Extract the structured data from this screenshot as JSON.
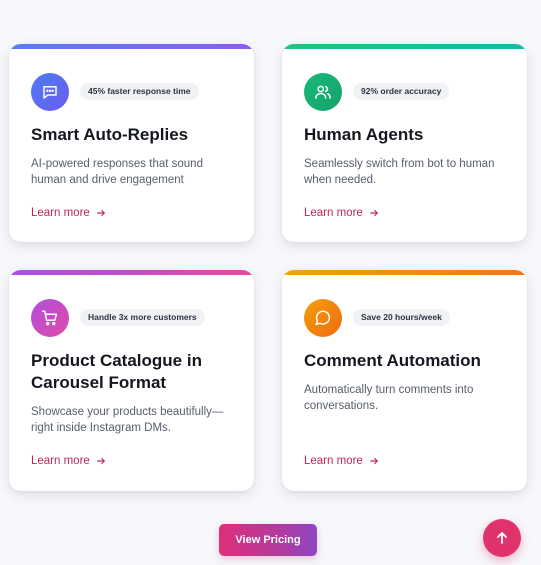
{
  "cards": [
    {
      "icon": "chat-dots-icon",
      "badge": "45% faster response time",
      "title": "Smart Auto-Replies",
      "description": "AI-powered responses that sound human and drive engagement",
      "link": "Learn more",
      "colors": {
        "bar": [
          "#5b7cf0",
          "#8a5cf0"
        ],
        "icon": [
          "#4d7bf3",
          "#6a5cf0"
        ]
      }
    },
    {
      "icon": "users-icon",
      "badge": "92% order accuracy",
      "title": "Human Agents",
      "description": "Seamlessly switch from bot to human when needed.",
      "link": "Learn more",
      "colors": {
        "bar": [
          "#22c57a",
          "#14b8a6"
        ],
        "icon": [
          "#18b87a",
          "#15a36c"
        ]
      }
    },
    {
      "icon": "cart-icon",
      "badge": "Handle 3x more customers",
      "title": "Product Catalogue in Carousel Format",
      "description": "Showcase your products beautifully—right inside Instagram DMs.",
      "link": "Learn more",
      "colors": {
        "bar": [
          "#a64ff2",
          "#ec4899"
        ],
        "icon": [
          "#b14fe0",
          "#e04aa6"
        ]
      }
    },
    {
      "icon": "comment-icon",
      "badge": "Save 20 hours/week",
      "title": "Comment Automation",
      "description": "Automatically turn comments into conversations.",
      "link": "Learn more",
      "colors": {
        "bar": [
          "#f5a30b",
          "#f97316"
        ],
        "icon": [
          "#f59e0b",
          "#ef6c12"
        ]
      }
    }
  ],
  "view_pricing_label": "View Pricing",
  "scroll_top": {
    "icon": "arrow-up-icon",
    "color": "#e0336b"
  },
  "link_color": "#c0265b"
}
